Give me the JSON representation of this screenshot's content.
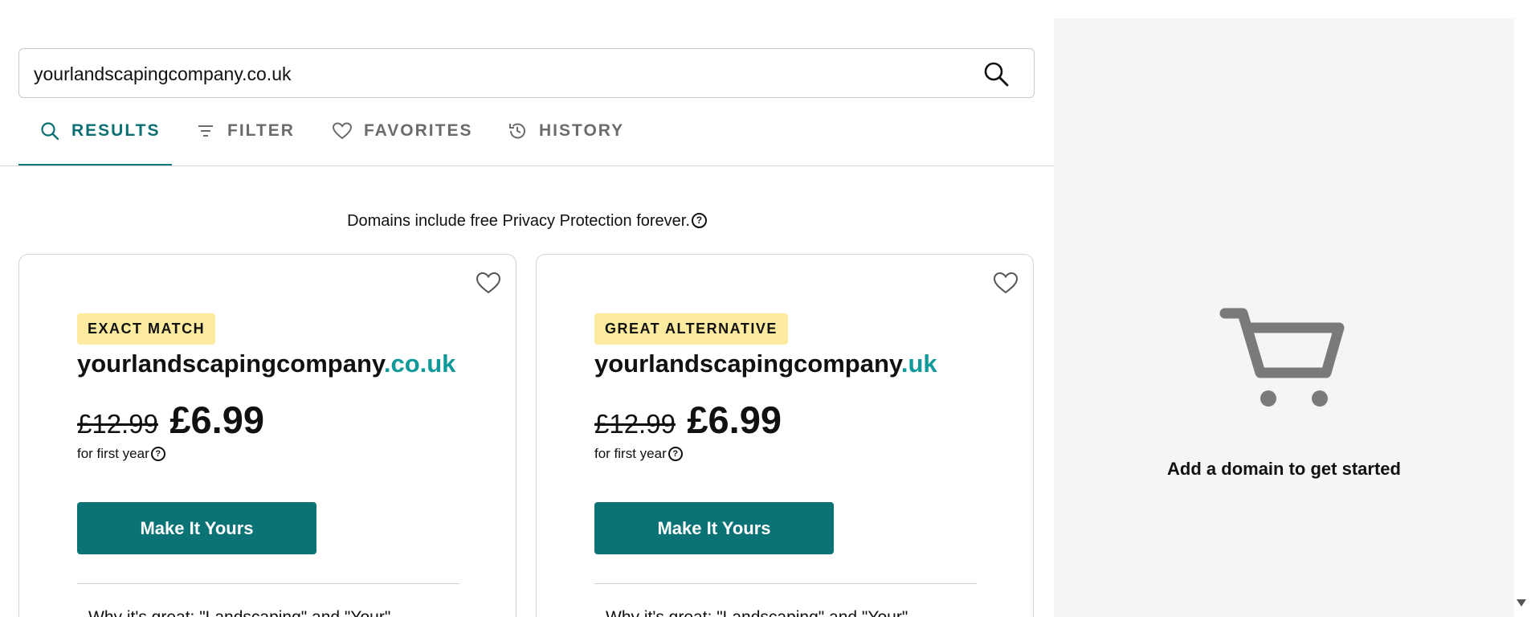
{
  "search": {
    "value": "yourlandscapingcompany.co.uk"
  },
  "tabs": [
    {
      "label": "RESULTS",
      "icon": "search-icon"
    },
    {
      "label": "FILTER",
      "icon": "filter-icon"
    },
    {
      "label": "FAVORITES",
      "icon": "heart-icon"
    },
    {
      "label": "HISTORY",
      "icon": "history-icon"
    }
  ],
  "privacy_note": "Domains include free Privacy Protection forever.",
  "help_glyph": "?",
  "cards": [
    {
      "badge": "EXACT MATCH",
      "domain_name": "yourlandscapingcompany",
      "domain_tld": ".co.uk",
      "old_price": "£12.99",
      "new_price": "£6.99",
      "term": "for first year",
      "cta": "Make It Yours",
      "why": "Why it's great: \"Landscaping\" and \"Your\"..."
    },
    {
      "badge": "GREAT ALTERNATIVE",
      "domain_name": "yourlandscapingcompany",
      "domain_tld": ".uk",
      "old_price": "£12.99",
      "new_price": "£6.99",
      "term": "for first year",
      "cta": "Make It Yours",
      "why": "Why it's great: \"Landscaping\" and \"Your\"..."
    }
  ],
  "cart": {
    "message": "Add a domain to get started"
  },
  "colors": {
    "accent": "#0b7276",
    "tld": "#10999b",
    "badge": "#fdeba0",
    "cart_bg": "#f4f5f6"
  }
}
